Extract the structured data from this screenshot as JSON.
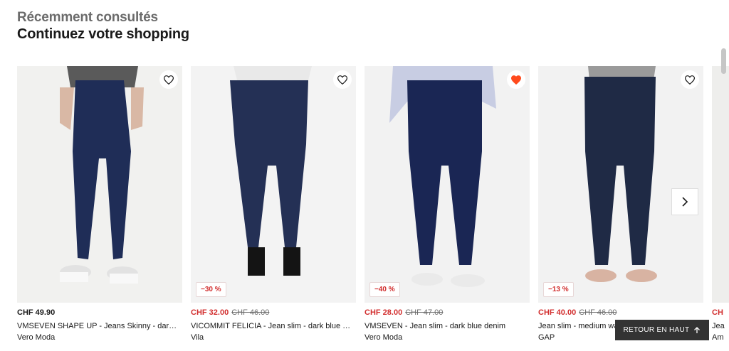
{
  "section": {
    "subtitle": "Récemment consultés",
    "title": "Continuez votre shopping"
  },
  "products": [
    {
      "price": "CHF 49.90",
      "old_price": "",
      "discount": "",
      "name": "VMSEVEN SHAPE UP - Jeans Skinny - dar…",
      "brand": "Vero Moda",
      "favorited": false
    },
    {
      "price": "CHF 32.00",
      "old_price": "CHF 46.00",
      "discount": "−30 %",
      "name": "VICOMMIT FELICIA - Jean slim - dark blue …",
      "brand": "Vila",
      "favorited": false
    },
    {
      "price": "CHF 28.00",
      "old_price": "CHF 47.00",
      "discount": "−40 %",
      "name": "VMSEVEN - Jean slim - dark blue denim",
      "brand": "Vero Moda",
      "favorited": true
    },
    {
      "price": "CHF 40.00",
      "old_price": "CHF 46.00",
      "discount": "−13 %",
      "name": "Jean slim - medium wash",
      "brand": "GAP",
      "favorited": false
    }
  ],
  "partial_card": {
    "price": "CH",
    "name": "Jea",
    "brand": "Am"
  },
  "carousel": {
    "next_icon": "chevron-right-icon"
  },
  "back_to_top": {
    "label": "RETOUR EN HAUT",
    "icon": "arrow-up-icon"
  },
  "colors": {
    "sale": "#d22e2e",
    "heart_active": "#ff4a1c",
    "text": "#1a1a1a",
    "muted": "#6b6b6b"
  }
}
